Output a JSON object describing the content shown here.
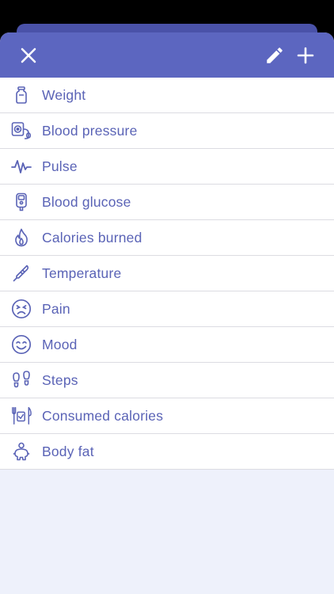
{
  "header": {
    "close_icon": "close-icon",
    "edit_icon": "pencil-icon",
    "add_icon": "plus-icon"
  },
  "colors": {
    "header": "#5c66c0",
    "accent_text": "#5a63b6",
    "background": "#eef1fb"
  },
  "items": [
    {
      "label": "Weight",
      "icon": "weight-icon"
    },
    {
      "label": "Blood pressure",
      "icon": "blood-pressure-icon"
    },
    {
      "label": "Pulse",
      "icon": "pulse-icon"
    },
    {
      "label": "Blood glucose",
      "icon": "glucometer-icon"
    },
    {
      "label": "Calories burned",
      "icon": "flame-icon"
    },
    {
      "label": "Temperature",
      "icon": "thermometer-icon"
    },
    {
      "label": "Pain",
      "icon": "pain-face-icon"
    },
    {
      "label": "Mood",
      "icon": "smile-face-icon"
    },
    {
      "label": "Steps",
      "icon": "footprints-icon"
    },
    {
      "label": "Consumed calories",
      "icon": "cutlery-icon"
    },
    {
      "label": "Body fat",
      "icon": "body-icon"
    }
  ]
}
